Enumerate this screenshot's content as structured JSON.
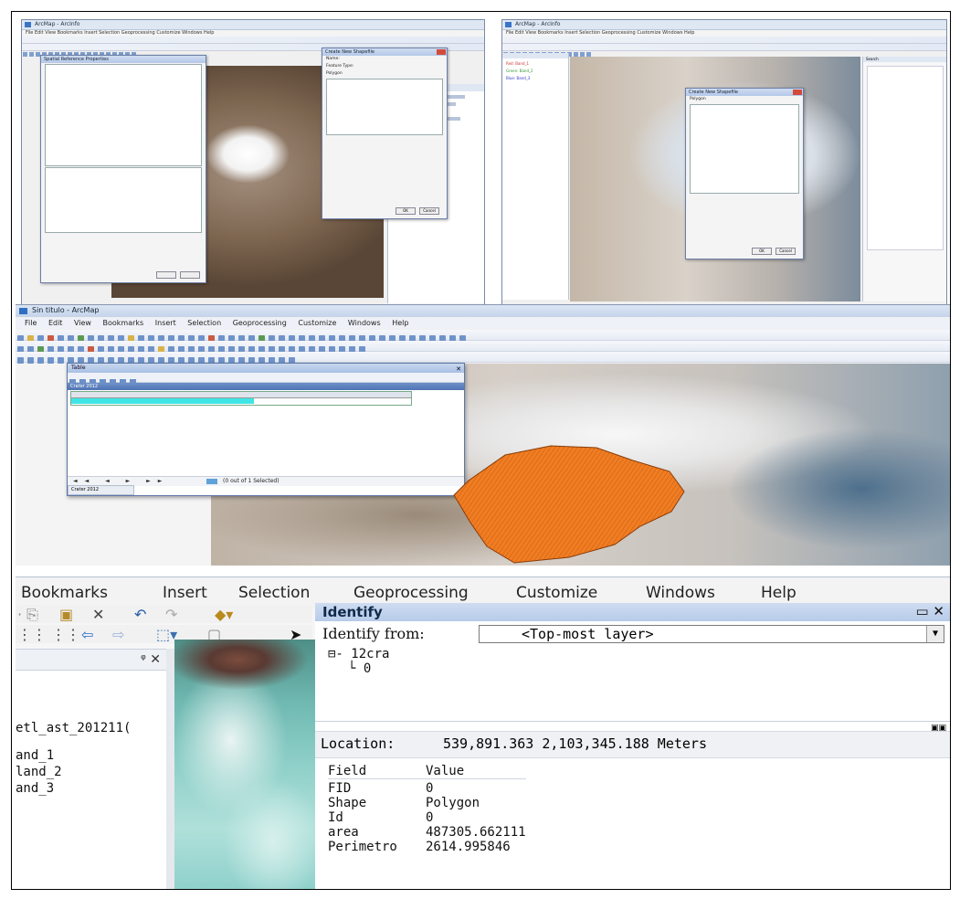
{
  "top_left": {
    "title": "ArcMap - ArcInfo",
    "menu": "File  Edit  View  Bookmarks  Insert  Selection  Geoprocessing  Customize  Windows  Help",
    "dialog_a_title": "Spatial Reference Properties",
    "dialog_b_title": "Create New Shapefile",
    "dialog_b_name": "Name:",
    "dialog_b_feature_type": "Feature Type:",
    "dialog_b_feature_value": "Polygon",
    "dialog_b_ok": "OK",
    "dialog_b_cancel": "Cancel"
  },
  "top_right": {
    "title": "ArcMap - ArcInfo",
    "dialog_title": "Create New Shapefile",
    "dialog_feature_value": "Polygon",
    "dialog_ok": "OK",
    "dialog_cancel": "Cancel",
    "legend": [
      "Red: Band_1",
      "Green: Band_2",
      "Blue: Band_3"
    ],
    "panel_label": "Search"
  },
  "mid": {
    "title": "Sin titulo - ArcMap",
    "menu": [
      "File",
      "Edit",
      "View",
      "Bookmarks",
      "Insert",
      "Selection",
      "Geoprocessing",
      "Customize",
      "Windows",
      "Help"
    ],
    "table_title": "Table",
    "table_layer": "Crater 2012",
    "table_footer": "(0 out of 1 Selected)",
    "table_tab": "Crater 2012",
    "polygon_color": "#f07d22"
  },
  "bottom": {
    "menu": [
      "Bookmarks",
      "Insert",
      "Selection",
      "Geoprocessing",
      "Customize",
      "Windows",
      "Help"
    ],
    "layers": [
      "etl_ast_201211(",
      "and_1",
      "land_2",
      "and_3"
    ],
    "identify": {
      "title": "Identify",
      "from_label": "Identify from:",
      "from_value": "<Top-most layer>",
      "tree_layer": "12cra",
      "tree_child": "0",
      "location_label": "Location:",
      "location_value": "539,891.363  2,103,345.188 Meters",
      "fields_header": [
        "Field",
        "Value"
      ],
      "fields": [
        {
          "field": "FID",
          "value": "0"
        },
        {
          "field": "Shape",
          "value": "Polygon"
        },
        {
          "field": "Id",
          "value": "0"
        },
        {
          "field": "area",
          "value": "487305.662111"
        },
        {
          "field": "Perimetro",
          "value": "2614.995846"
        }
      ]
    }
  }
}
